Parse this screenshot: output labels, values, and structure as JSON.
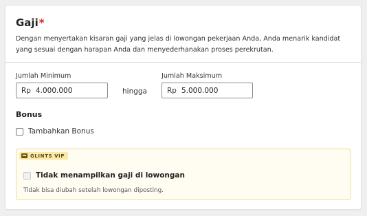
{
  "section": {
    "title": "Gaji",
    "required_marker": "*",
    "description": "Dengan menyertakan kisaran gaji yang jelas di lowongan pekerjaan Anda, Anda menarik kandidat yang sesuai dengan harapan Anda dan menyederhanakan proses perekrutan."
  },
  "salary": {
    "min_label": "Jumlah Minimum",
    "min_prefix": "Rp",
    "min_value": "4.000.000",
    "separator": "hingga",
    "max_label": "Jumlah Maksimum",
    "max_prefix": "Rp",
    "max_value": "5.000.000"
  },
  "bonus": {
    "heading": "Bonus",
    "checkbox_label": "Tambahkan Bonus",
    "checked": false
  },
  "vip": {
    "badge": "GLINTS VIP",
    "checkbox_label": "Tidak menampilkan gaji di lowongan",
    "note": "Tidak bisa diubah setelah lowongan diposting.",
    "checked": false,
    "accent_bg": "#fffdf2",
    "accent_border": "#f1dc96"
  },
  "colors": {
    "required": "#e02b27",
    "page_bg": "#efefef"
  }
}
